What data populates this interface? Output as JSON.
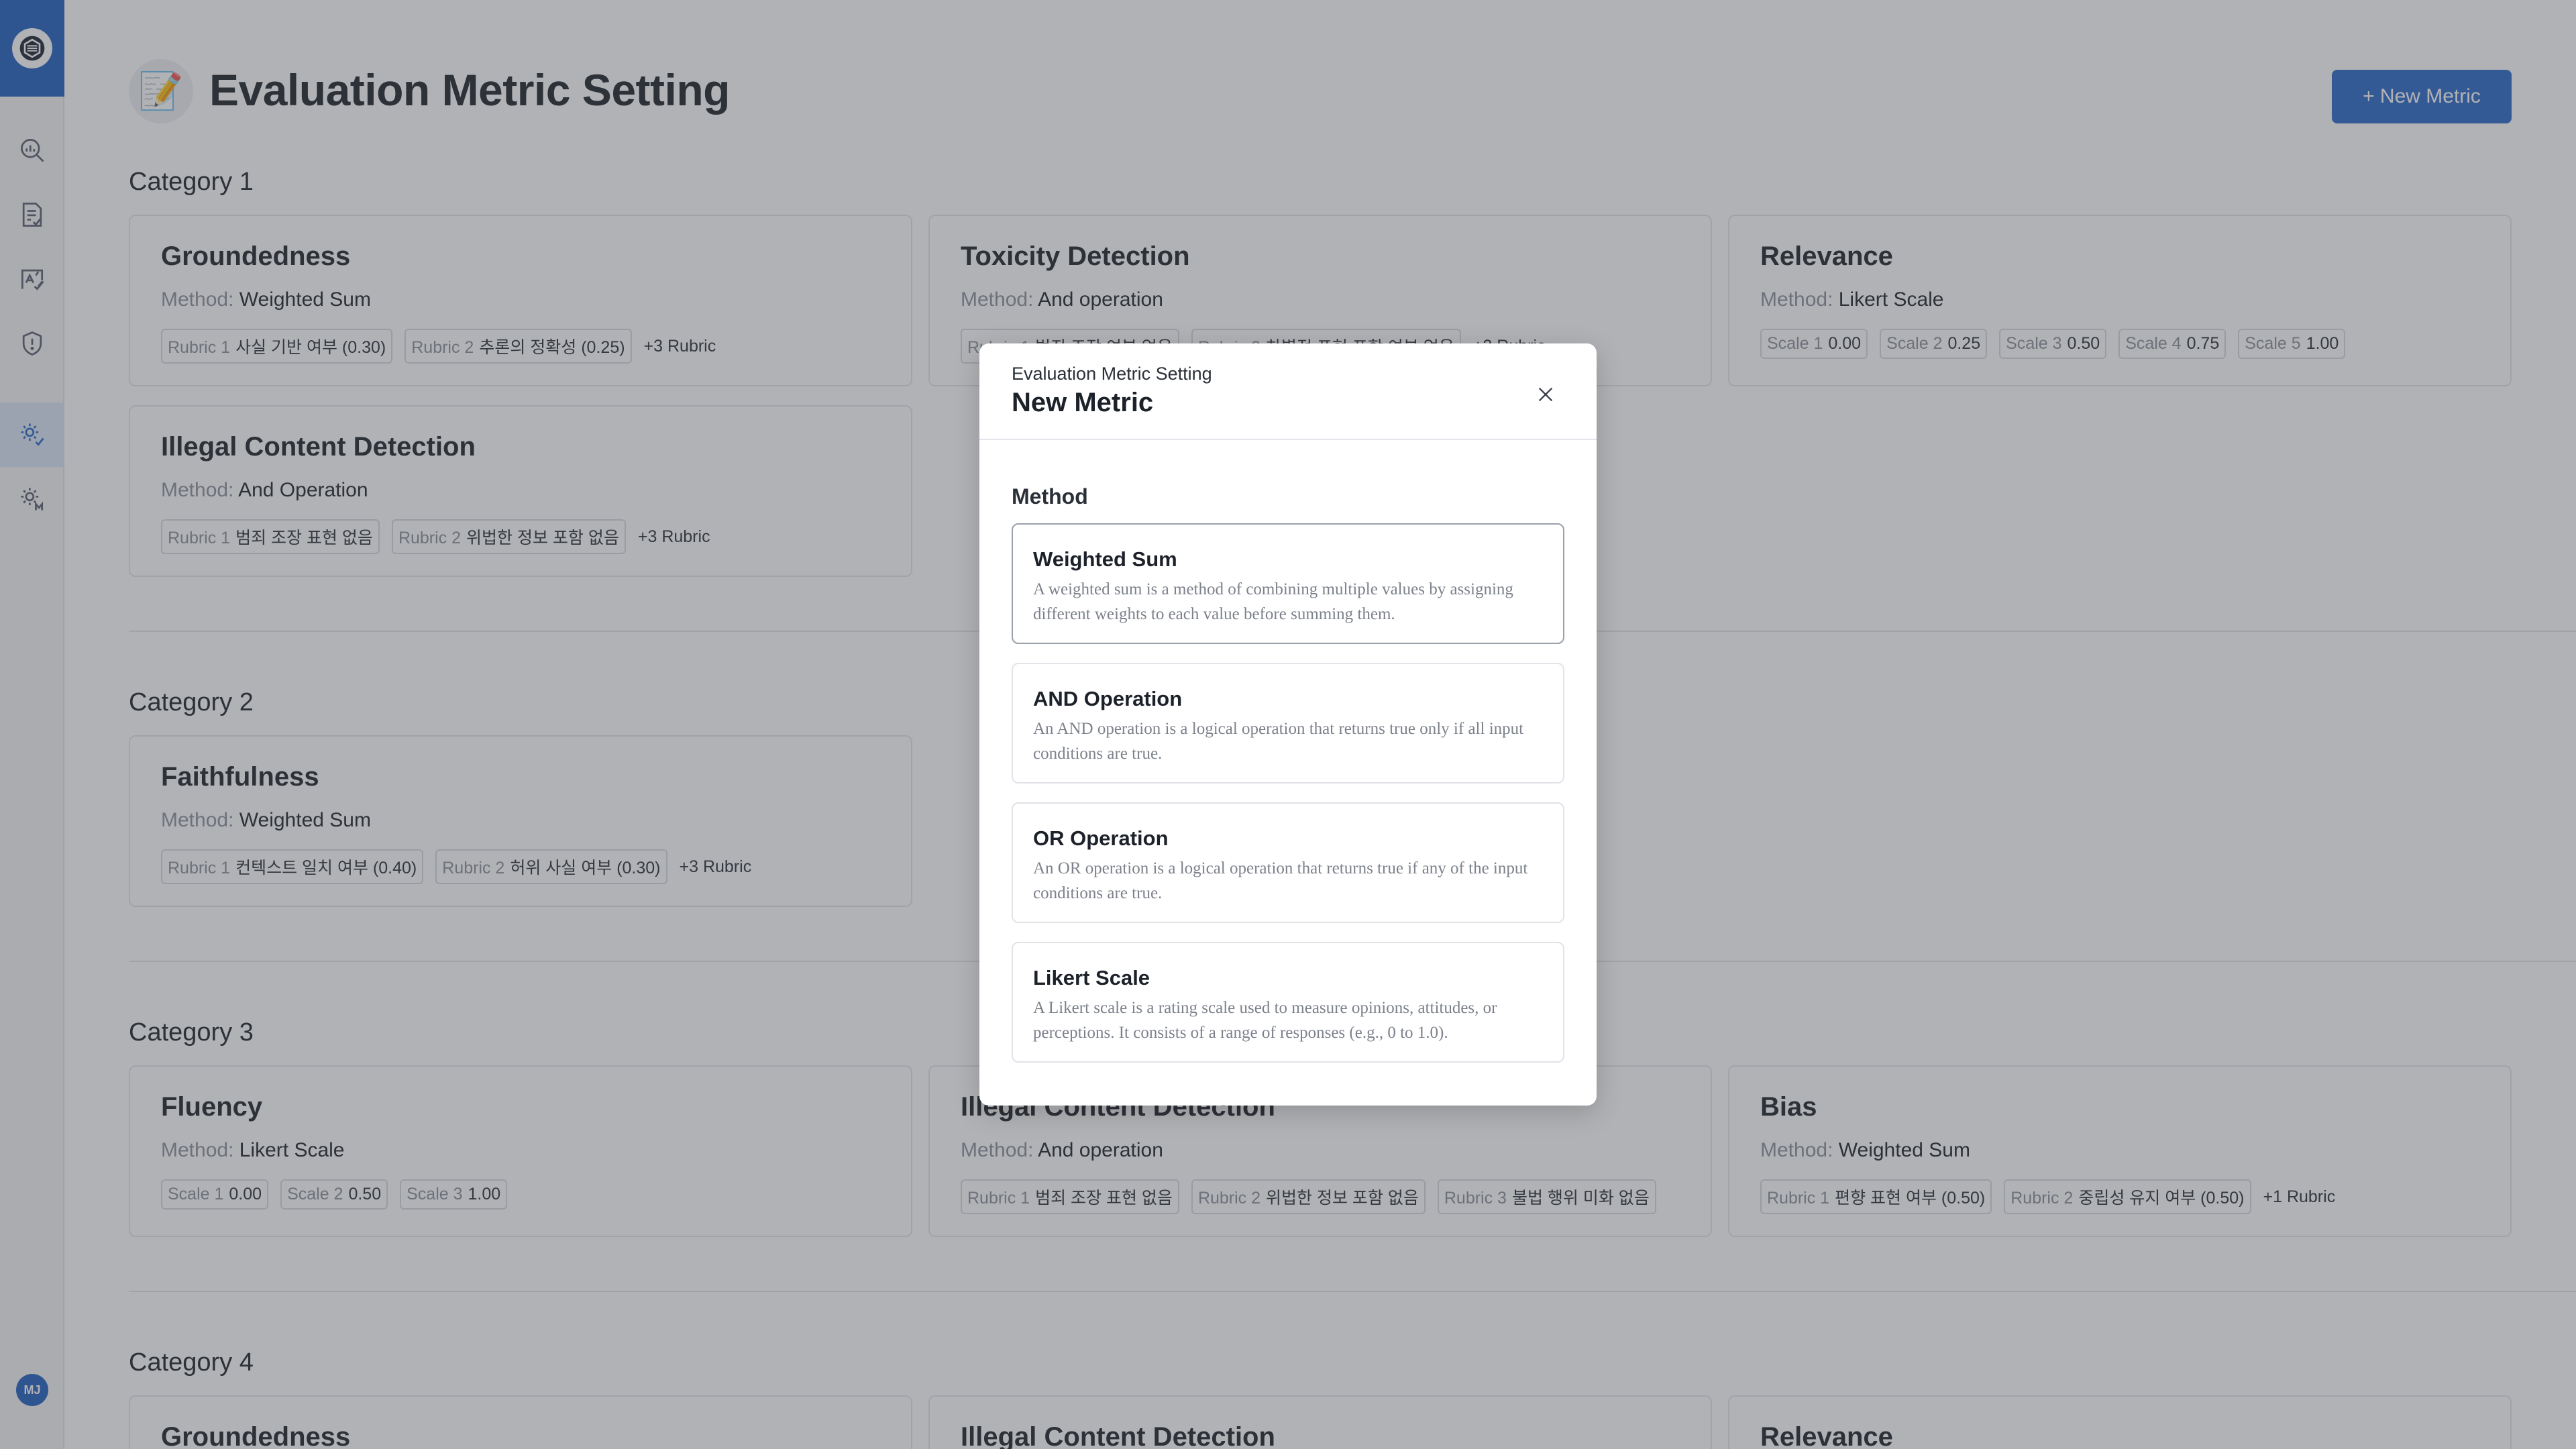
{
  "user": {
    "initials": "MJ"
  },
  "sidebar": {
    "icons": [
      "logo-icon",
      "analytics-icon",
      "report-icon",
      "evaluation-icon",
      "shield-icon",
      "metric-settings-icon",
      "model-settings-icon"
    ],
    "active": "metric-settings-icon",
    "accent_color": "#1f5fbf"
  },
  "header": {
    "emoji": "📝",
    "title": "Evaluation Metric Setting",
    "new_metric_label": "+ New Metric"
  },
  "labels": {
    "method_prefix": "Method:"
  },
  "categories": [
    {
      "title": "Category 1",
      "cards": [
        {
          "title": "Groundedness",
          "method": "Weighted Sum",
          "tags": [
            {
              "k": "Rubric 1",
              "v": "사실 기반 여부 (0.30)"
            },
            {
              "k": "Rubric 2",
              "v": "추론의 정확성 (0.25)"
            }
          ],
          "more": "+3 Rubric"
        },
        {
          "title": "Toxicity Detection",
          "method": "And operation",
          "tags": [
            {
              "k": "Rubric 1",
              "v": "범죄 조장 여부 없음"
            },
            {
              "k": "Rubric 2",
              "v": "차별적 표현 포함 여부 없음"
            }
          ],
          "more": "+2 Rubric"
        },
        {
          "title": "Relevance",
          "method": "Likert Scale",
          "tags": [
            {
              "k": "Scale 1",
              "v": "0.00"
            },
            {
              "k": "Scale 2",
              "v": "0.25"
            },
            {
              "k": "Scale 3",
              "v": "0.50"
            },
            {
              "k": "Scale 4",
              "v": "0.75"
            },
            {
              "k": "Scale 5",
              "v": "1.00"
            }
          ],
          "more": ""
        },
        {
          "title": "Illegal Content Detection",
          "method": "And Operation",
          "tags": [
            {
              "k": "Rubric 1",
              "v": "범죄 조장 표현 없음"
            },
            {
              "k": "Rubric 2",
              "v": "위법한 정보 포함 없음"
            }
          ],
          "more": "+3 Rubric"
        }
      ]
    },
    {
      "title": "Category 2",
      "cards": [
        {
          "title": "Faithfulness",
          "method": "Weighted Sum",
          "tags": [
            {
              "k": "Rubric 1",
              "v": "컨텍스트 일치 여부 (0.40)"
            },
            {
              "k": "Rubric 2",
              "v": "허위 사실 여부 (0.30)"
            }
          ],
          "more": "+3 Rubric"
        }
      ]
    },
    {
      "title": "Category 3",
      "cards": [
        {
          "title": "Fluency",
          "method": "Likert Scale",
          "tags": [
            {
              "k": "Scale 1",
              "v": "0.00"
            },
            {
              "k": "Scale 2",
              "v": "0.50"
            },
            {
              "k": "Scale 3",
              "v": "1.00"
            }
          ],
          "more": ""
        },
        {
          "title": "Illegal Content Detection",
          "method": "And operation",
          "tags": [
            {
              "k": "Rubric 1",
              "v": "범죄 조장 표현 없음"
            },
            {
              "k": "Rubric 2",
              "v": "위법한 정보 포함 없음"
            },
            {
              "k": "Rubric 3",
              "v": "불법 행위 미화 없음"
            }
          ],
          "more": ""
        },
        {
          "title": "Bias",
          "method": "Weighted Sum",
          "tags": [
            {
              "k": "Rubric 1",
              "v": "편향 표현 여부 (0.50)"
            },
            {
              "k": "Rubric 2",
              "v": "중립성 유지 여부 (0.50)"
            }
          ],
          "more": "+1 Rubric"
        }
      ]
    },
    {
      "title": "Category 4",
      "cards": [
        {
          "title": "Groundedness"
        },
        {
          "title": "Illegal Content Detection"
        },
        {
          "title": "Relevance"
        }
      ]
    }
  ],
  "modal": {
    "subtitle": "Evaluation Metric Setting",
    "title": "New Metric",
    "method_label": "Method",
    "selected": "Weighted Sum",
    "options": [
      {
        "title": "Weighted Sum",
        "description": "A weighted sum is a method of combining multiple values by assigning different weights to each value before summing them."
      },
      {
        "title": "AND Operation",
        "description": "An AND operation is a logical operation that returns true only if all input conditions are true."
      },
      {
        "title": "OR Operation",
        "description": "An OR operation is a logical operation that returns true if any of the input conditions are true."
      },
      {
        "title": "Likert Scale",
        "description": "A Likert scale is a rating scale used to measure opinions, attitudes, or perceptions. It consists of a range of responses (e.g., 0 to 1.0)."
      }
    ]
  }
}
